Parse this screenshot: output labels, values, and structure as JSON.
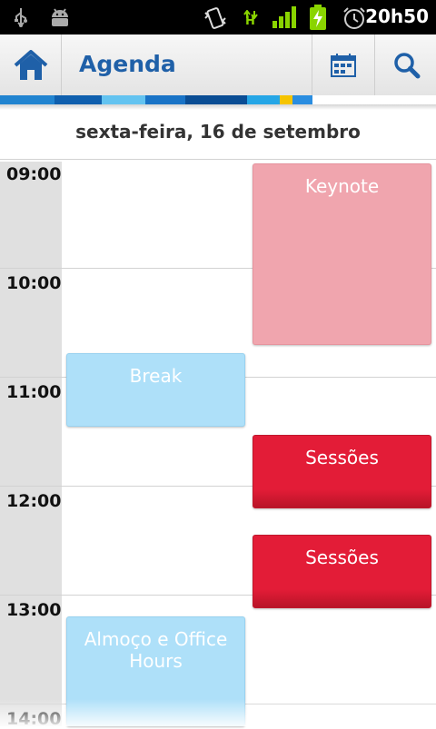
{
  "status_bar": {
    "time": "20h50",
    "network_label": "H",
    "icons": [
      "usb-icon",
      "android-debug-icon",
      "vibrate-icon",
      "data-hspa-icon",
      "signal-icon",
      "battery-charging-icon",
      "alarm-icon"
    ]
  },
  "action_bar": {
    "title": "Agenda",
    "icons": [
      "home-icon",
      "calendar-icon",
      "search-icon"
    ]
  },
  "day_header": "sexta-feira, 16 de setembro",
  "hours": [
    "09:00",
    "10:00",
    "11:00",
    "12:00",
    "13:00",
    "14:00"
  ],
  "events": [
    {
      "title": "Keynote",
      "color": "#f0a5ae"
    },
    {
      "title": "Break",
      "color": "#aee0f9"
    },
    {
      "title": "Sessões",
      "color": "#e31c37"
    },
    {
      "title": "Sessões",
      "color": "#e31c37"
    },
    {
      "title": "Almoço e Office Hours",
      "color": "#aee0f9"
    }
  ],
  "colors": {
    "accent": "#1f60a8",
    "strip": [
      "#2184d0",
      "#0f5fae",
      "#63c3f0",
      "#1973c6",
      "#0a4d94",
      "#25a6e6",
      "#f5c400",
      "#2a8de0"
    ]
  }
}
